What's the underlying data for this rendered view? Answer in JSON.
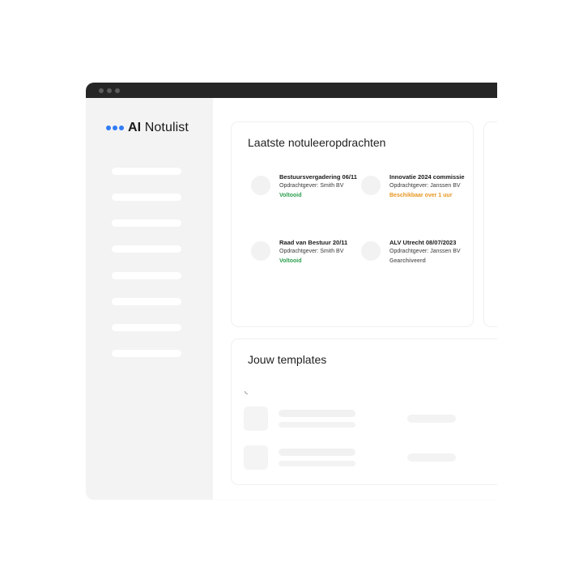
{
  "app": {
    "logo_dots_color": "#2f7cf6",
    "logo_bold": "AI",
    "logo_rest": " Notulist"
  },
  "sidebar": {
    "items": [
      "",
      "",
      "",
      "",
      "",
      "",
      "",
      ""
    ]
  },
  "recent": {
    "title": "Laatste notuleeropdrachten",
    "items": [
      {
        "title": "Bestuursvergadering 06/11",
        "client": "Opdrachtgever: Smith BV",
        "status": "Voltooid",
        "status_color": "#2e9e4f"
      },
      {
        "title": "Innovatie 2024 commissie",
        "client": "Opdrachtgever: Janssen BV",
        "status": "Beschikbaar over 1 uur",
        "status_color": "#e8951f"
      },
      {
        "title": "Raad van Bestuur 20/11",
        "client": "Opdrachtgever: Smith BV",
        "status": "Voltooid",
        "status_color": "#2e9e4f"
      },
      {
        "title": "ALV Utrecht 08/07/2023",
        "client": "Opdrachtgever: Janssen BV",
        "status": "Gearchiveerd",
        "status_color": "#6b6b6b"
      }
    ]
  },
  "templates": {
    "title": "Jouw templates"
  }
}
